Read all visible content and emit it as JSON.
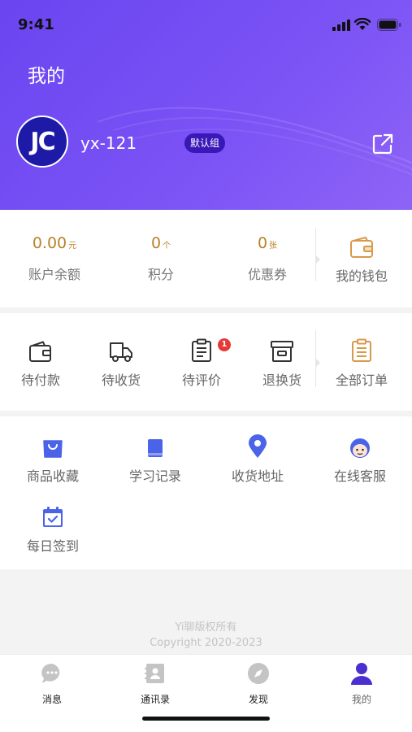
{
  "status_bar": {
    "time": "9:41"
  },
  "header": {
    "title": "我的",
    "avatar_text": "JC",
    "username": "yx-121",
    "group_badge": "默认组"
  },
  "assets": {
    "items": [
      {
        "value": "0.00",
        "unit": "元",
        "label": "账户余额"
      },
      {
        "value": "0",
        "unit": "个",
        "label": "积分"
      },
      {
        "value": "0",
        "unit": "张",
        "label": "优惠券"
      }
    ],
    "wallet_label": "我的钱包"
  },
  "orders": {
    "items": [
      {
        "label": "待付款",
        "icon": "wallet-icon"
      },
      {
        "label": "待收货",
        "icon": "truck-icon"
      },
      {
        "label": "待评价",
        "icon": "clipboard-icon",
        "badge": "1"
      },
      {
        "label": "退换货",
        "icon": "archive-box-icon"
      }
    ],
    "all_label": "全部订单"
  },
  "services": {
    "items": [
      {
        "label": "商品收藏",
        "icon": "shopping-bag-icon"
      },
      {
        "label": "学习记录",
        "icon": "book-icon"
      },
      {
        "label": "收货地址",
        "icon": "location-pin-icon"
      },
      {
        "label": "在线客服",
        "icon": "customer-service-icon"
      },
      {
        "label": "每日签到",
        "icon": "calendar-check-icon"
      }
    ]
  },
  "footer": {
    "line1": "Yi聊版权所有",
    "line2": "Copyright 2020-2023"
  },
  "tabbar": {
    "items": [
      {
        "label": "消息",
        "icon": "chat-bubble-icon"
      },
      {
        "label": "通讯录",
        "icon": "contacts-icon"
      },
      {
        "label": "发现",
        "icon": "compass-icon"
      },
      {
        "label": "我的",
        "icon": "user-icon",
        "active": true
      }
    ]
  },
  "colors": {
    "header_gradient_start": "#6a45f0",
    "header_gradient_end": "#8e63f7",
    "accent_gold": "#b8822a",
    "icon_blue": "#4a63e8",
    "badge_red": "#e53935",
    "tab_active": "#4b2fd0"
  }
}
